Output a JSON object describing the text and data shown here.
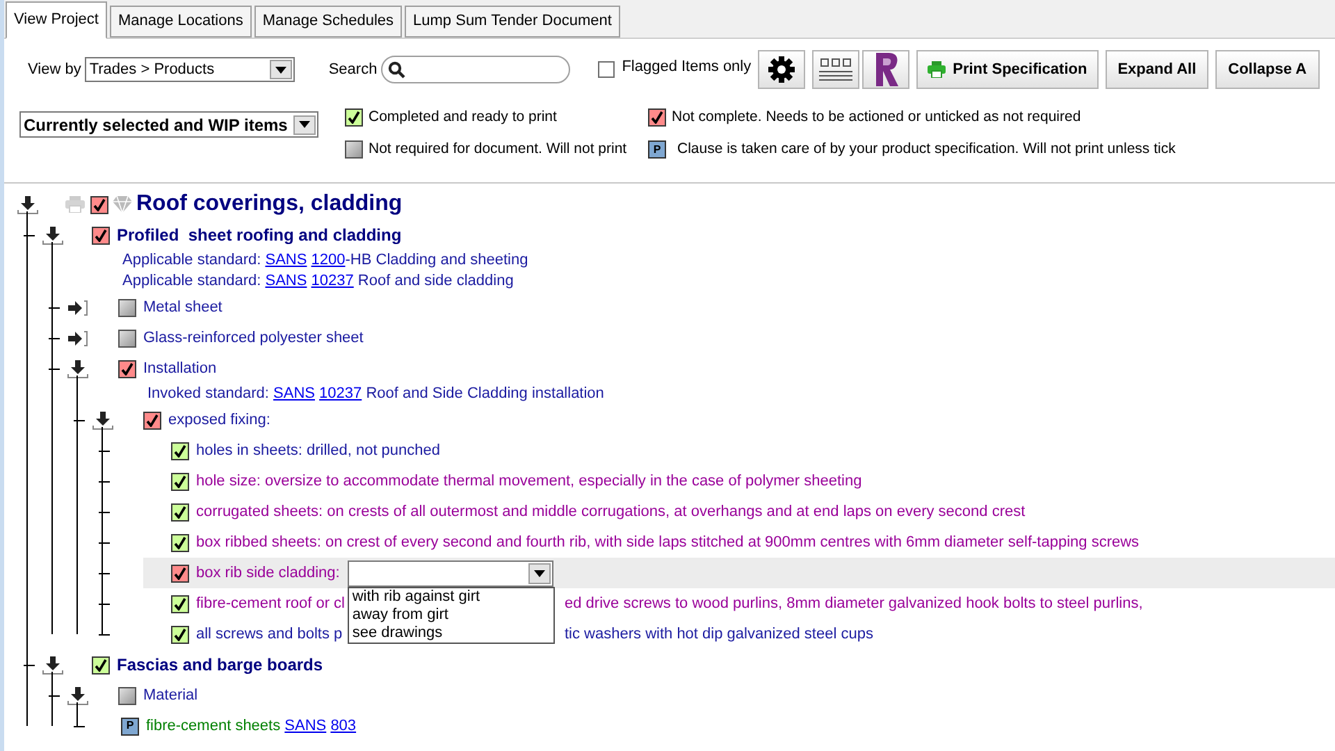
{
  "tabs": [
    {
      "label": "View Project",
      "selected": true
    },
    {
      "label": "Manage Locations",
      "selected": false
    },
    {
      "label": "Manage Schedules",
      "selected": false
    },
    {
      "label": "Lump Sum Tender Document",
      "selected": false
    }
  ],
  "toolbar": {
    "view_by": {
      "label": "View by",
      "value": "Trades > Products"
    },
    "search": {
      "label": "Search"
    },
    "flagged": {
      "label": "Flagged Items only",
      "checked": false
    },
    "buttons": [
      {
        "kind": "settings"
      },
      {
        "kind": "layout"
      },
      {
        "kind": "r-logo"
      },
      {
        "kind": "print",
        "label": "Print Specification"
      },
      {
        "kind": "text",
        "label": "Expand All"
      },
      {
        "kind": "text",
        "label": "Collapse A"
      }
    ]
  },
  "filter": {
    "value": "Currently selected and WIP items"
  },
  "legend": [
    {
      "kind": "checkbox",
      "checked": true,
      "text": "Completed and ready to print"
    },
    {
      "kind": "checkbox",
      "checked": true,
      "incomplete": true,
      "text": "Not complete. Needs to be actioned or unticked as not required"
    },
    {
      "kind": "checkbox",
      "checked": false,
      "text": "Not required for document. Will not print"
    },
    {
      "kind": "product",
      "badge": "P",
      "text": "Clause is taken care of by your product specification. Will not print unless tick"
    }
  ],
  "tree": [
    {
      "kind": "section",
      "title": "Roof coverings, cladding",
      "checked": true,
      "incomplete": true,
      "expanded": true,
      "children": [
        {
          "kind": "heading",
          "title": "Profiled  sheet roofing and cladding",
          "checked": true,
          "incomplete": true,
          "expanded": true,
          "children": [
            {
              "kind": "reference",
              "parts": [
                {
                  "text": "Applicable standard: "
                },
                {
                  "text": "SANS",
                  "link": true
                },
                {
                  "text": "1200",
                  "link": true
                },
                {
                  "text": "-HB Cladding and sheeting"
                }
              ]
            },
            {
              "kind": "reference",
              "parts": [
                {
                  "text": "Applicable standard: "
                },
                {
                  "text": "SANS",
                  "link": true
                },
                {
                  "text": "10237",
                  "link": true
                },
                {
                  "text": " Roof and side cladding"
                }
              ]
            },
            {
              "kind": "item",
              "title": "Metal sheet",
              "checked": false,
              "expanded": false
            },
            {
              "kind": "item",
              "title": "Glass-reinforced polyester sheet",
              "checked": false,
              "expanded": false
            },
            {
              "kind": "item",
              "title": "Installation",
              "checked": true,
              "incomplete": true,
              "expanded": true,
              "children": [
                {
                  "kind": "reference",
                  "parts": [
                    {
                      "text": "Invoked standard: "
                    },
                    {
                      "text": "SANS",
                      "link": true
                    },
                    {
                      "text": "10237",
                      "link": true
                    },
                    {
                      "text": " Roof and Side Cladding installation"
                    }
                  ]
                },
                {
                  "kind": "item",
                  "title": "exposed fixing:",
                  "checked": true,
                  "incomplete": true,
                  "expanded": true,
                  "children": [
                    {
                      "kind": "clause",
                      "text": "holes in sheets: drilled, not punched",
                      "checked": true,
                      "color": "#1a1aa0"
                    },
                    {
                      "kind": "clause",
                      "text": "hole size: oversize to accommodate thermal movement, especially in the case of polymer sheeting",
                      "checked": true,
                      "color": "#990099"
                    },
                    {
                      "kind": "clause",
                      "text": "corrugated sheets: on crests of all outermost and middle corrugations, at overhangs and at end laps on every second crest",
                      "checked": true,
                      "color": "#990099"
                    },
                    {
                      "kind": "clause",
                      "text": "box ribbed sheets: on crest of every second and fourth rib, with side laps stitched at 900mm centres with 6mm diameter self-tapping screws",
                      "checked": true,
                      "color": "#990099"
                    },
                    {
                      "kind": "select",
                      "text": "box rib side cladding:",
                      "checked": true,
                      "incomplete": true,
                      "color": "#990099",
                      "open": true,
                      "options": [
                        "with rib against girt",
                        "away from girt",
                        "see drawings"
                      ]
                    },
                    {
                      "kind": "clause",
                      "text": "fibre-cement roof or cl",
                      "text_after": "ed drive screws to wood purlins, 8mm diameter galvanized hook bolts to steel purlins,",
                      "checked": true,
                      "color": "#990099"
                    },
                    {
                      "kind": "clause",
                      "text": "all screws and bolts p",
                      "text_after": "tic washers with hot dip galvanized steel cups",
                      "checked": true,
                      "color": "#1a1aa0"
                    }
                  ]
                }
              ]
            }
          ]
        },
        {
          "kind": "heading",
          "title": "Fascias and barge boards",
          "checked": true,
          "expanded": true,
          "children": [
            {
              "kind": "item",
              "title": "Material",
              "checked": false,
              "expanded": true,
              "children": [
                {
                  "kind": "product",
                  "badge": "P",
                  "color": "#008000",
                  "parts": [
                    {
                      "text": "fibre-cement sheets "
                    },
                    {
                      "text": "SANS",
                      "link": true
                    },
                    {
                      "text": "803",
                      "link": true
                    }
                  ]
                }
              ]
            }
          ]
        }
      ]
    }
  ]
}
